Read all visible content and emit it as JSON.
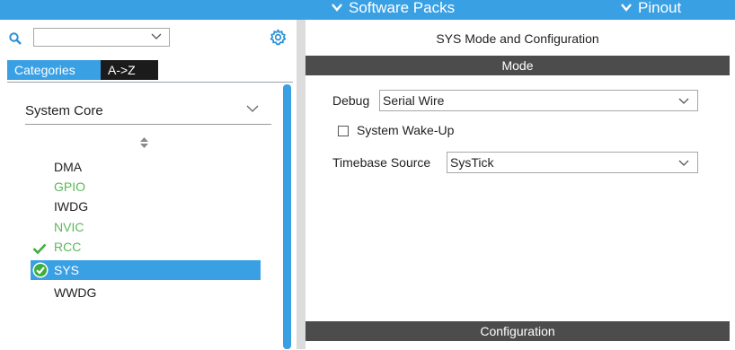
{
  "top_menu": {
    "software_packs": "Software Packs",
    "pinout": "Pinout"
  },
  "left_panel": {
    "search_value": "",
    "tabs": [
      "Categories",
      "A->Z"
    ],
    "active_tab": "Categories",
    "category": "System Core",
    "items": [
      {
        "label": "DMA",
        "state": "default"
      },
      {
        "label": "GPIO",
        "state": "configured"
      },
      {
        "label": "IWDG",
        "state": "default"
      },
      {
        "label": "NVIC",
        "state": "configured"
      },
      {
        "label": "RCC",
        "state": "checked"
      },
      {
        "label": "SYS",
        "state": "selected"
      },
      {
        "label": "WWDG",
        "state": "default"
      }
    ]
  },
  "right_panel": {
    "title": "SYS Mode and Configuration",
    "mode_header": "Mode",
    "debug_label": "Debug",
    "debug_value": "Serial Wire",
    "wakeup_label": "System Wake-Up",
    "wakeup_checked": false,
    "timebase_label": "Timebase Source",
    "timebase_value": "SysTick",
    "config_header": "Configuration"
  },
  "colors": {
    "accent": "#3aa0e4",
    "header_dark": "#4c4c4c",
    "configured_green": "#5ab85a"
  },
  "icons": [
    "chevron-down-icon",
    "search-icon",
    "gear-icon",
    "sort-icon",
    "checkmark-icon",
    "check-circle-icon"
  ]
}
